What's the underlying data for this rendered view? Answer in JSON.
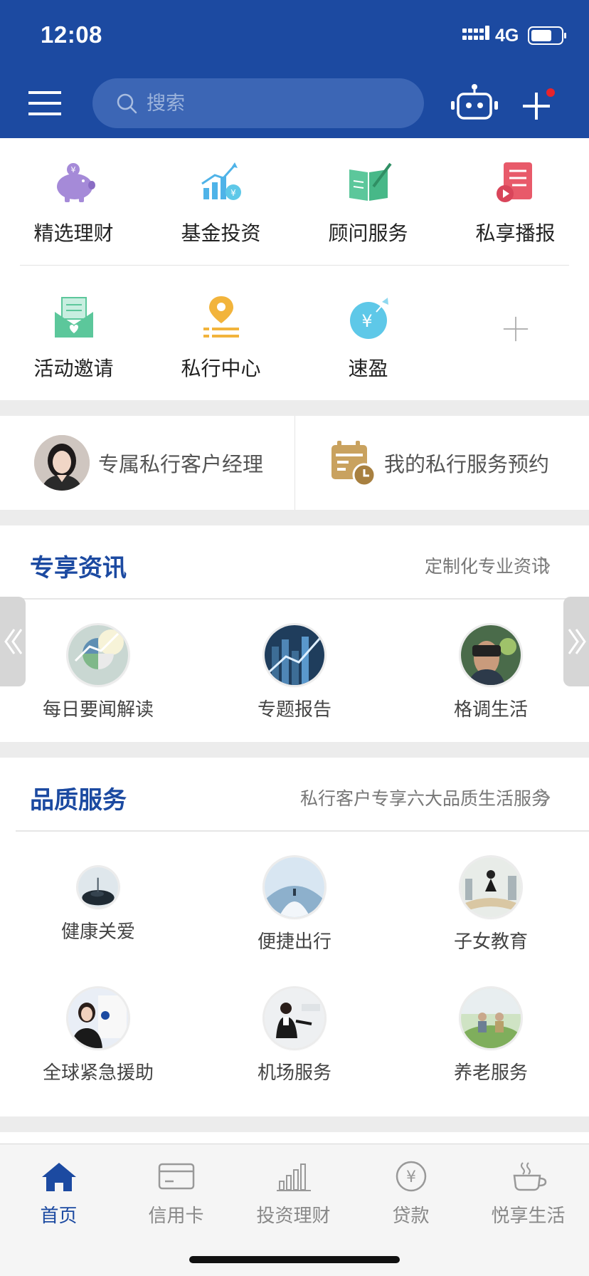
{
  "status_bar": {
    "time": "12:08",
    "network": "4G"
  },
  "header": {
    "search_placeholder": "搜索"
  },
  "quick_menu": [
    {
      "label": "精选理财",
      "icon": "piggy-bank-icon"
    },
    {
      "label": "基金投资",
      "icon": "growth-chart-icon"
    },
    {
      "label": "顾问服务",
      "icon": "book-pen-icon"
    },
    {
      "label": "私享播报",
      "icon": "scroll-play-icon"
    },
    {
      "label": "活动邀请",
      "icon": "invitation-envelope-icon"
    },
    {
      "label": "私行中心",
      "icon": "location-pin-icon"
    },
    {
      "label": "速盈",
      "icon": "yuan-coin-icon"
    }
  ],
  "advisor": {
    "manager_label": "专属私行客户经理",
    "appointment_label": "我的私行服务预约"
  },
  "news_section": {
    "title": "专享资讯",
    "link": "定制化专业资讯",
    "items": [
      {
        "label": "每日要闻解读"
      },
      {
        "label": "专题报告"
      },
      {
        "label": "格调生活"
      }
    ]
  },
  "service_section": {
    "title": "品质服务",
    "link": "私行客户专享六大品质生活服务",
    "items": [
      {
        "label": "健康关爱"
      },
      {
        "label": "便捷出行"
      },
      {
        "label": "子女教育"
      },
      {
        "label": "全球紧急援助"
      },
      {
        "label": "机场服务"
      },
      {
        "label": "养老服务"
      }
    ]
  },
  "bottom_nav": [
    {
      "label": "首页",
      "active": true
    },
    {
      "label": "信用卡",
      "active": false
    },
    {
      "label": "投资理财",
      "active": false
    },
    {
      "label": "贷款",
      "active": false
    },
    {
      "label": "悦享生活",
      "active": false
    }
  ],
  "colors": {
    "brand_blue": "#1c4aa1",
    "search_bg": "#3c66b5",
    "notification_red": "#e8232b"
  }
}
